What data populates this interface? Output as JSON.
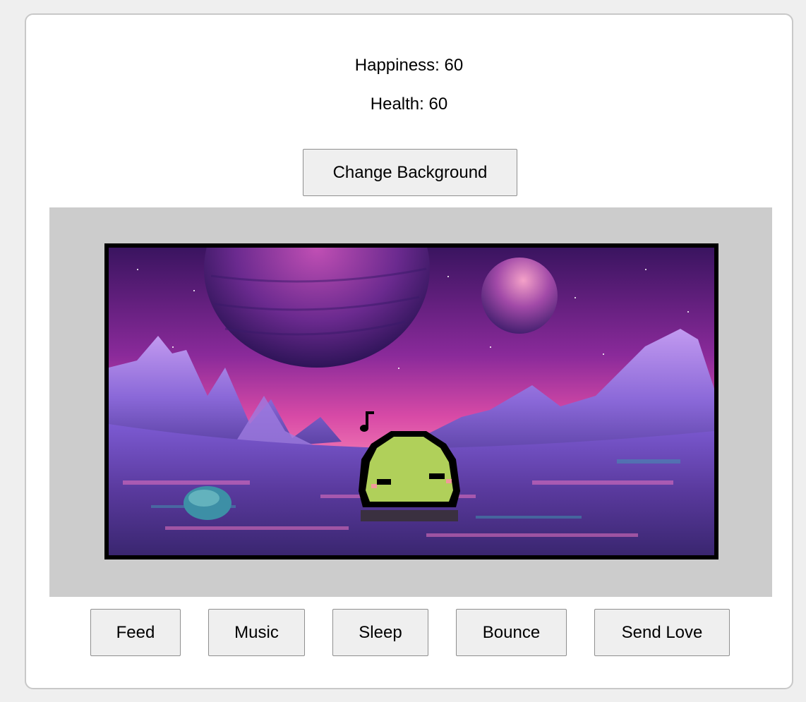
{
  "stats": {
    "happiness_label": "Happiness:",
    "happiness_value": "60",
    "health_label": "Health:",
    "health_value": "60"
  },
  "controls": {
    "change_background_label": "Change Background"
  },
  "actions": {
    "feed_label": "Feed",
    "music_label": "Music",
    "sleep_label": "Sleep",
    "bounce_label": "Bounce",
    "send_love_label": "Send Love"
  },
  "scene": {
    "background_theme": "pixel-art purple alien planet with mountains and two moons",
    "pet_state": "singing",
    "pet_color": "#b0d05a",
    "note_icon": "music-note-icon"
  },
  "colors": {
    "page_bg": "#efefef",
    "card_bg": "#ffffff",
    "stage_bg": "#cccccc",
    "button_bg": "#efefef"
  }
}
